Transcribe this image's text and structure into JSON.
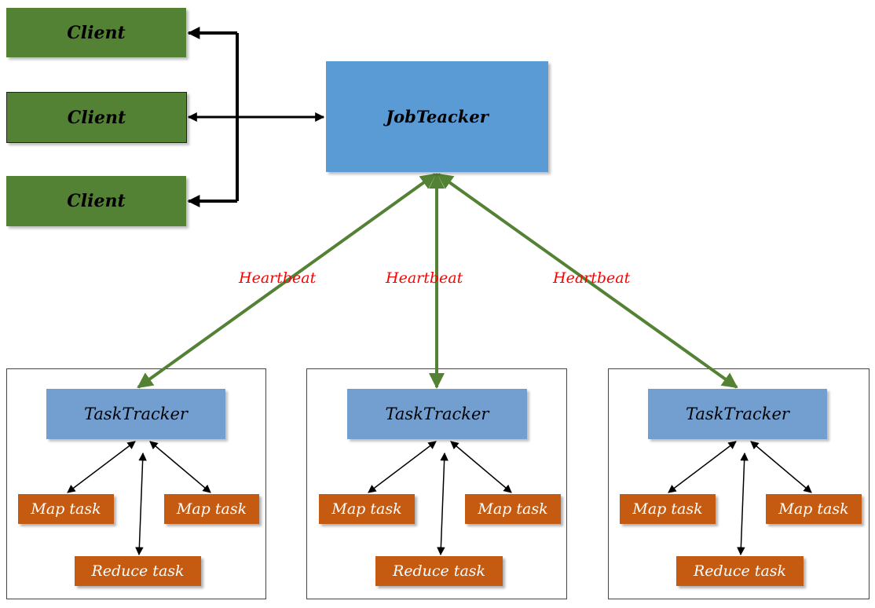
{
  "diagram": {
    "clients": [
      {
        "label": "Client"
      },
      {
        "label": "Client"
      },
      {
        "label": "Client"
      }
    ],
    "job_tracker": {
      "label": "JobTeacker"
    },
    "heartbeat_labels": [
      "Heartbeat",
      "Heartbeat",
      "Heartbeat"
    ],
    "nodes": [
      {
        "task_tracker": "TaskTracker",
        "map_tasks": [
          "Map task",
          "Map task"
        ],
        "reduce_task": "Reduce task"
      },
      {
        "task_tracker": "TaskTracker",
        "map_tasks": [
          "Map task",
          "Map task"
        ],
        "reduce_task": "Reduce task"
      },
      {
        "task_tracker": "TaskTracker",
        "map_tasks": [
          "Map task",
          "Map task"
        ],
        "reduce_task": "Reduce task"
      }
    ],
    "colors": {
      "client": "#548235",
      "job_tracker": "#5b9bd5",
      "task_tracker": "#729fcf",
      "task": "#c55a11",
      "heartbeat_arrow": "#548235",
      "heartbeat_text": "#ff0000"
    }
  }
}
